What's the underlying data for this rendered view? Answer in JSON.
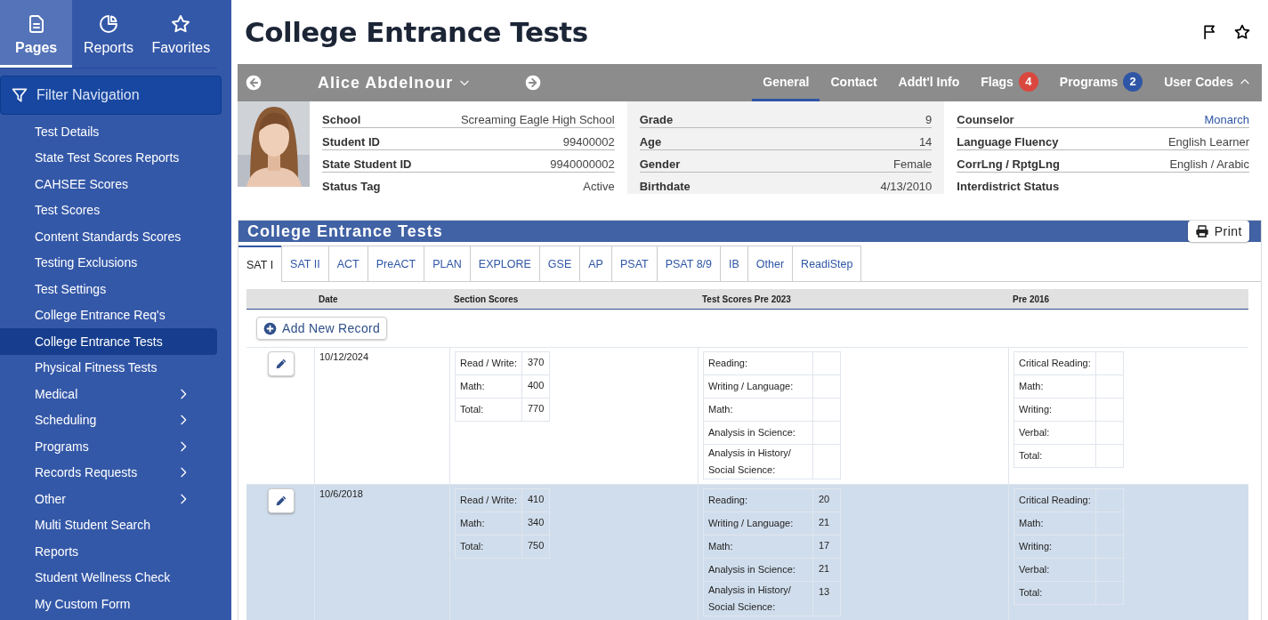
{
  "sidebar": {
    "tabs": [
      {
        "label": "Pages",
        "selected": true
      },
      {
        "label": "Reports",
        "selected": false
      },
      {
        "label": "Favorites",
        "selected": false
      }
    ],
    "filter": {
      "placeholder": "Filter Navigation"
    },
    "items": [
      {
        "label": "Test Details",
        "selected": false,
        "expandable": false
      },
      {
        "label": "State Test Scores Reports",
        "selected": false,
        "expandable": false
      },
      {
        "label": "CAHSEE Scores",
        "selected": false,
        "expandable": false
      },
      {
        "label": "Test Scores",
        "selected": false,
        "expandable": false
      },
      {
        "label": "Content Standards Scores",
        "selected": false,
        "expandable": false
      },
      {
        "label": "Testing Exclusions",
        "selected": false,
        "expandable": false
      },
      {
        "label": "Test Settings",
        "selected": false,
        "expandable": false
      },
      {
        "label": "College Entrance Req's",
        "selected": false,
        "expandable": false
      },
      {
        "label": "College Entrance Tests",
        "selected": true,
        "expandable": false
      },
      {
        "label": "Physical Fitness Tests",
        "selected": false,
        "expandable": false
      },
      {
        "label": "Medical",
        "selected": false,
        "expandable": true
      },
      {
        "label": "Scheduling",
        "selected": false,
        "expandable": true
      },
      {
        "label": "Programs",
        "selected": false,
        "expandable": true
      },
      {
        "label": "Records Requests",
        "selected": false,
        "expandable": true
      },
      {
        "label": "Other",
        "selected": false,
        "expandable": true
      },
      {
        "label": "Multi Student Search",
        "selected": false,
        "expandable": false
      },
      {
        "label": "Reports",
        "selected": false,
        "expandable": false
      },
      {
        "label": "Student Wellness Check",
        "selected": false,
        "expandable": false
      },
      {
        "label": "My Custom Form",
        "selected": false,
        "expandable": false
      }
    ]
  },
  "page_title": "College Entrance Tests",
  "student": {
    "name": "Alice Abdelnour",
    "tabs": [
      {
        "label": "General",
        "selected": true
      },
      {
        "label": "Contact",
        "selected": false
      },
      {
        "label": "Addt'l Info",
        "selected": false
      },
      {
        "label": "Flags",
        "selected": false,
        "badge": {
          "text": "4",
          "color": "#d9473f"
        }
      },
      {
        "label": "Programs",
        "selected": false,
        "badge": {
          "text": "2",
          "color": "#2f56a6"
        }
      },
      {
        "label": "User Codes",
        "selected": false,
        "expanded": true
      }
    ],
    "photo": {
      "kind": "picture"
    },
    "columns": [
      [
        {
          "label": "School",
          "value": "Screaming Eagle High School"
        },
        {
          "label": "Student ID",
          "value": "99400002"
        },
        {
          "label": "State Student ID",
          "value": "9940000002"
        },
        {
          "label": "Status Tag",
          "value": "Active"
        }
      ],
      [
        {
          "label": "Grade",
          "value": "9"
        },
        {
          "label": "Age",
          "value": "14"
        },
        {
          "label": "Gender",
          "value": "Female"
        },
        {
          "label": "Birthdate",
          "value": "4/13/2010"
        }
      ],
      [
        {
          "label": "Counselor",
          "value": "Monarch",
          "link": true
        },
        {
          "label": "Language Fluency",
          "value": "English Learner"
        },
        {
          "label": "CorrLng / RptgLng",
          "value": "English / Arabic"
        },
        {
          "label": "Interdistrict Status"
        }
      ]
    ]
  },
  "tests": {
    "title": "College Entrance Tests",
    "print_button": "Print",
    "tabs": [
      {
        "label": "SAT I",
        "selected": true
      },
      {
        "label": "SAT II",
        "selected": false
      },
      {
        "label": "ACT",
        "selected": false
      },
      {
        "label": "PreACT",
        "selected": false
      },
      {
        "label": "PLAN",
        "selected": false
      },
      {
        "label": "EXPLORE",
        "selected": false
      },
      {
        "label": "GSE",
        "selected": false
      },
      {
        "label": "AP",
        "selected": false
      },
      {
        "label": "PSAT",
        "selected": false
      },
      {
        "label": "PSAT 8/9",
        "selected": false
      },
      {
        "label": "IB",
        "selected": false
      },
      {
        "label": "Other",
        "selected": false
      },
      {
        "label": "ReadiStep",
        "selected": false
      }
    ],
    "columns": [
      "Date",
      "Section Scores",
      "Test Scores Pre 2023",
      "Pre 2016"
    ],
    "add_button": "Add New Record",
    "rows": [
      {
        "date": "10/12/2024",
        "selected": false,
        "section": [
          {
            "label": "Read / Write:",
            "value": "370"
          },
          {
            "label": "Math:",
            "value": "400"
          },
          {
            "label": "Total:",
            "value": "770"
          }
        ],
        "pre2023": [
          {
            "label": "Reading:"
          },
          {
            "label": "Writing / Language:"
          },
          {
            "label": "Math:"
          },
          {
            "label": "Analysis in Science:"
          },
          {
            "label": "Analysis in History/ Social Science:"
          }
        ],
        "pre2016": [
          {
            "label": "Critical Reading:"
          },
          {
            "label": "Math:"
          },
          {
            "label": "Writing:"
          },
          {
            "label": "Verbal:"
          },
          {
            "label": "Total:"
          }
        ]
      },
      {
        "date": "10/6/2018",
        "selected": true,
        "section": [
          {
            "label": "Read / Write:",
            "value": "410"
          },
          {
            "label": "Math:",
            "value": "340"
          },
          {
            "label": "Total:",
            "value": "750"
          }
        ],
        "pre2023": [
          {
            "label": "Reading:",
            "value": "20"
          },
          {
            "label": "Writing / Language:",
            "value": "21"
          },
          {
            "label": "Math:",
            "value": "17"
          },
          {
            "label": "Analysis in Science:",
            "value": "21"
          },
          {
            "label": "Analysis in History/ Social Science:",
            "value": "13"
          }
        ],
        "pre2016": [
          {
            "label": "Critical Reading:"
          },
          {
            "label": "Math:"
          },
          {
            "label": "Writing:"
          },
          {
            "label": "Verbal:"
          },
          {
            "label": "Total:"
          }
        ]
      }
    ]
  }
}
